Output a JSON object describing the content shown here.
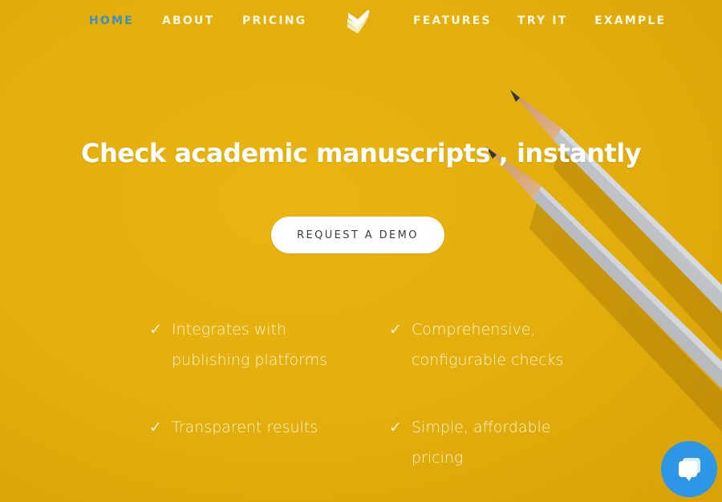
{
  "nav": {
    "items": [
      {
        "label": "HOME",
        "active": true
      },
      {
        "label": "ABOUT",
        "active": false
      },
      {
        "label": "PRICING",
        "active": false
      },
      {
        "label": "FEATURES",
        "active": false
      },
      {
        "label": "TRY IT",
        "active": false
      },
      {
        "label": "EXAMPLE",
        "active": false
      }
    ],
    "logo_icon": "stacked-check-pages-logo",
    "active_color": "#3a8fc4"
  },
  "hero": {
    "headline_part1": "Check ",
    "headline_part2": "academic manuscripts",
    "headline_part3": " , instantly",
    "cta_label": "REQUEST A DEMO"
  },
  "features": [
    {
      "icon": "check-icon",
      "check": "✓",
      "line1": "Integrates with",
      "line2": "publishing platforms"
    },
    {
      "icon": "check-icon",
      "check": "✓",
      "line1": "Comprehensive,",
      "line2": "configurable checks"
    },
    {
      "icon": "check-icon",
      "check": "✓",
      "line1": "Transparent results",
      "line2": ""
    },
    {
      "icon": "check-icon",
      "check": "✓",
      "line1": "Simple, affordable",
      "line2": "pricing"
    }
  ],
  "chat": {
    "icon": "chat-bubbles-icon",
    "color": "#2e96e6"
  },
  "colors": {
    "background": "#e3ad0c",
    "text": "#ffffff"
  }
}
